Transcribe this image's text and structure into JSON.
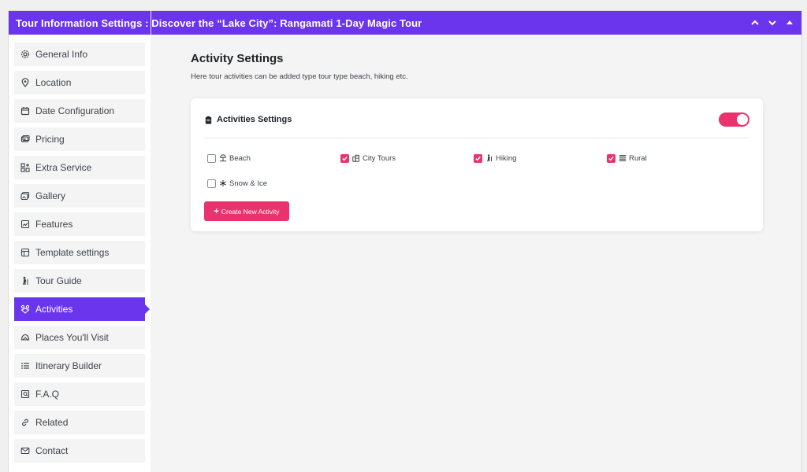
{
  "header": {
    "title": "Tour Information Settings : Discover the “Lake City”: Rangamati 1-Day Magic Tour",
    "controls": [
      "chevron-up-icon",
      "chevron-down-icon",
      "triangle-up-icon"
    ]
  },
  "sidebar": {
    "items": [
      {
        "label": "General Info",
        "icon": "gear-icon"
      },
      {
        "label": "Location",
        "icon": "map-pin-icon"
      },
      {
        "label": "Date Configuration",
        "icon": "calendar-icon"
      },
      {
        "label": "Pricing",
        "icon": "price-tag-icon"
      },
      {
        "label": "Extra Service",
        "icon": "grid-plus-icon"
      },
      {
        "label": "Gallery",
        "icon": "gallery-icon"
      },
      {
        "label": "Features",
        "icon": "features-icon"
      },
      {
        "label": "Template settings",
        "icon": "template-icon"
      },
      {
        "label": "Tour Guide",
        "icon": "person-icon"
      },
      {
        "label": "Activities",
        "icon": "activities-icon",
        "active": true
      },
      {
        "label": "Places You'll Visit",
        "icon": "places-icon"
      },
      {
        "label": "Itinerary Builder",
        "icon": "list-icon"
      },
      {
        "label": "F.A.Q",
        "icon": "faq-icon"
      },
      {
        "label": "Related",
        "icon": "link-icon"
      },
      {
        "label": "Contact",
        "icon": "mail-icon"
      }
    ]
  },
  "main": {
    "title": "Activity Settings",
    "description": "Here tour activities can be added type tour type beach, hiking etc.",
    "card": {
      "title": "Activities Settings",
      "toggle_on": true,
      "activities": [
        {
          "label": "Beach",
          "checked": false,
          "icon": "beach-icon"
        },
        {
          "label": "City Tours",
          "checked": true,
          "icon": "city-icon"
        },
        {
          "label": "Hiking",
          "checked": true,
          "icon": "hiking-icon"
        },
        {
          "label": "Rural",
          "checked": true,
          "icon": "rural-icon"
        },
        {
          "label": "Snow & Ice",
          "checked": false,
          "icon": "snow-icon"
        }
      ],
      "create_button": "Create New Activity"
    }
  },
  "colors": {
    "accent": "#6b35ee",
    "pink": "#e8336e"
  }
}
